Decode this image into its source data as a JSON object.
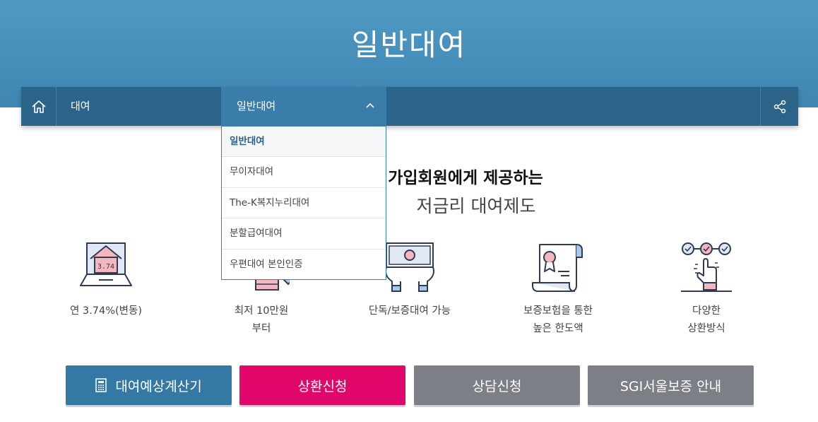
{
  "hero": {
    "title": "일반대여"
  },
  "nav": {
    "home_icon": "home-icon",
    "crumb1": "대여",
    "crumb2": "일반대여",
    "share_icon": "share-icon"
  },
  "dropdown": {
    "items": [
      {
        "label": "일반대여",
        "active": true
      },
      {
        "label": "무이자대여"
      },
      {
        "label": "The-K복지누리대여"
      },
      {
        "label": "분할급여대여"
      },
      {
        "label": "우편대여 본인인증"
      }
    ]
  },
  "headline": {
    "line1": "가입회원에게 제공하는",
    "line2": "저금리 대여제도"
  },
  "features": [
    {
      "icon": "laptop-rate-icon",
      "label1": "연 3.74%(변동)",
      "label2": "",
      "badge": "3.74"
    },
    {
      "icon": "money-stack-icon",
      "label1": "최저 10만원",
      "label2": "부터"
    },
    {
      "icon": "cash-hands-icon",
      "label1": "단독/보증대여 가능",
      "label2": ""
    },
    {
      "icon": "certificate-icon",
      "label1": "보증보험을 통한",
      "label2": "높은 한도액"
    },
    {
      "icon": "choice-hand-icon",
      "label1": "다양한",
      "label2": "상환방식"
    }
  ],
  "buttons": {
    "calc": "대여예상계산기",
    "repay": "상환신청",
    "consult": "상담신청",
    "sgi": "SGI서울보증 안내"
  },
  "colors": {
    "hero": "#4f9ac4",
    "navbar": "#2c6489",
    "nav_active": "#3a7dab",
    "primary_btn": "#3478a4",
    "accent_btn": "#e2086b",
    "gray_btn": "#7d7f86"
  }
}
